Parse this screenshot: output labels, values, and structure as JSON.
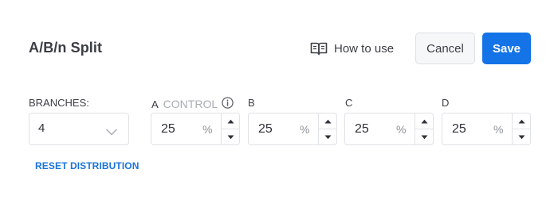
{
  "header": {
    "title": "A/B/n Split",
    "how_to_use_label": "How to use",
    "cancel_label": "Cancel",
    "save_label": "Save"
  },
  "branches": {
    "label": "BRANCHES:",
    "selected": "4"
  },
  "distribution": [
    {
      "letter": "A",
      "tag": "CONTROL",
      "value": "25",
      "unit": "%"
    },
    {
      "letter": "B",
      "tag": "",
      "value": "25",
      "unit": "%"
    },
    {
      "letter": "C",
      "tag": "",
      "value": "25",
      "unit": "%"
    },
    {
      "letter": "D",
      "tag": "",
      "value": "25",
      "unit": "%"
    }
  ],
  "reset_label": "RESET DISTRIBUTION",
  "colors": {
    "accent": "#1473e6",
    "link": "#1a73d9",
    "muted": "#a9adb4"
  },
  "icons": {
    "how_to_use": "book-open-icon",
    "control_info": "info-icon",
    "dropdown": "chevron-down-icon",
    "increment": "caret-up-icon",
    "decrement": "caret-down-icon"
  }
}
